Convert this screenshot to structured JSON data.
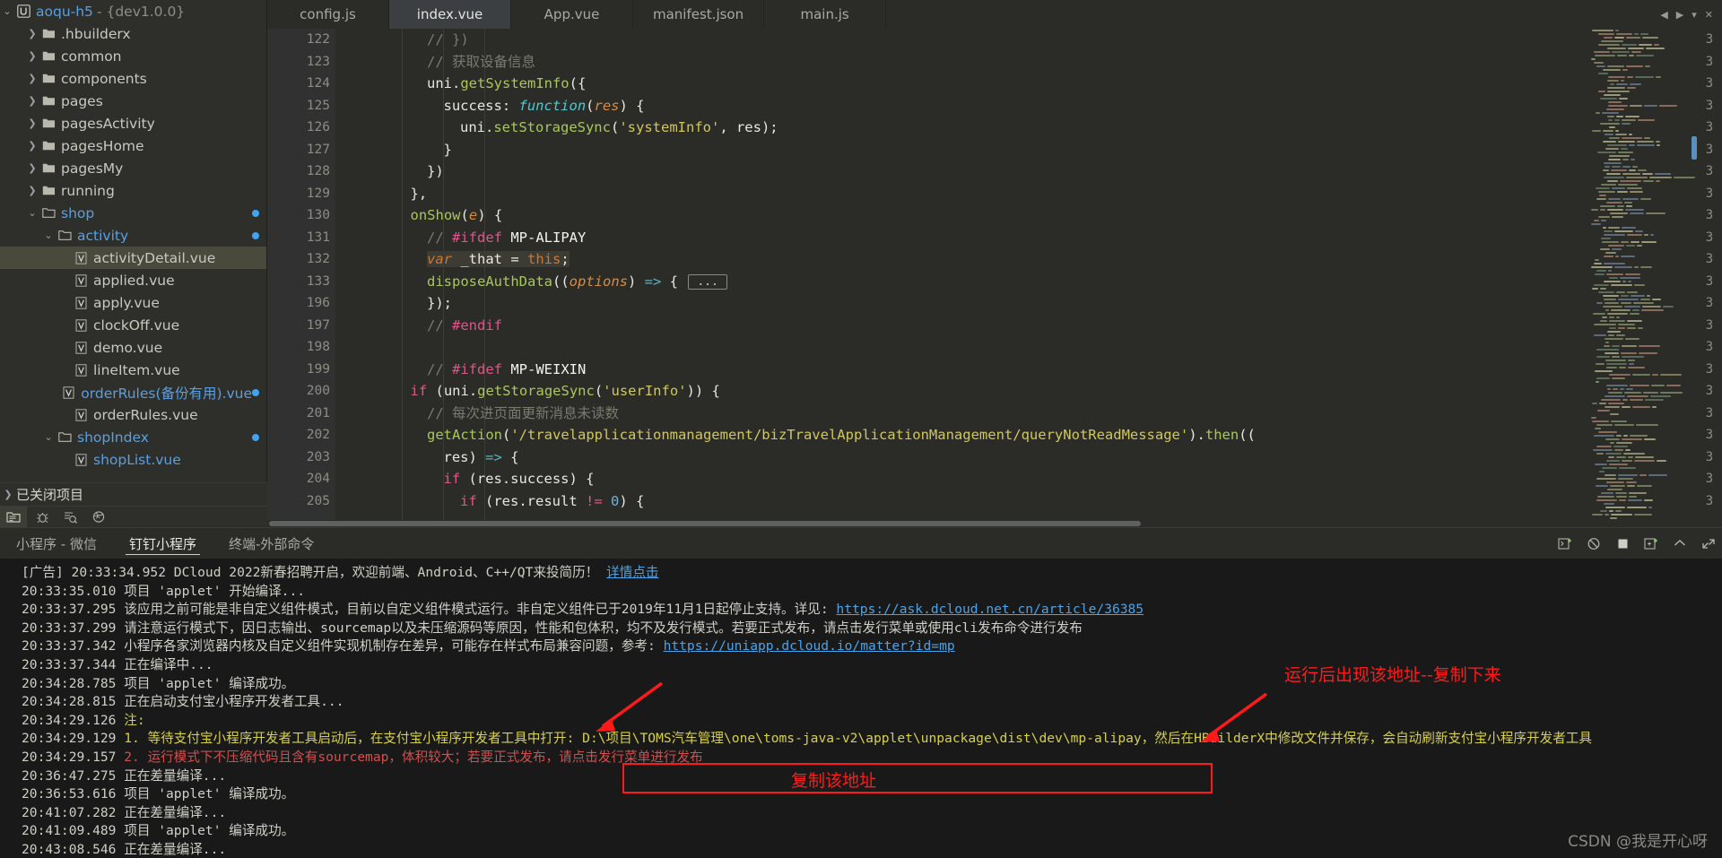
{
  "sidebar": {
    "root": {
      "name": "aoqu-h5",
      "version": "- {dev1.0.0}",
      "icon": "hbuilder-logo-icon"
    },
    "items": [
      {
        "label": ".hbuilderx",
        "type": "folder",
        "depth": 1,
        "expanded": false,
        "dot": false,
        "color": "grey"
      },
      {
        "label": "common",
        "type": "folder",
        "depth": 1,
        "expanded": false,
        "dot": false,
        "color": "grey"
      },
      {
        "label": "components",
        "type": "folder",
        "depth": 1,
        "expanded": false,
        "dot": false,
        "color": "grey"
      },
      {
        "label": "pages",
        "type": "folder",
        "depth": 1,
        "expanded": false,
        "dot": false,
        "color": "grey"
      },
      {
        "label": "pagesActivity",
        "type": "folder",
        "depth": 1,
        "expanded": false,
        "dot": false,
        "color": "grey"
      },
      {
        "label": "pagesHome",
        "type": "folder",
        "depth": 1,
        "expanded": false,
        "dot": false,
        "color": "grey"
      },
      {
        "label": "pagesMy",
        "type": "folder",
        "depth": 1,
        "expanded": false,
        "dot": false,
        "color": "grey"
      },
      {
        "label": "running",
        "type": "folder",
        "depth": 1,
        "expanded": false,
        "dot": false,
        "color": "grey"
      },
      {
        "label": "shop",
        "type": "folder",
        "depth": 1,
        "expanded": true,
        "dot": true,
        "color": "blue"
      },
      {
        "label": "activity",
        "type": "folder",
        "depth": 2,
        "expanded": true,
        "dot": true,
        "color": "blue"
      },
      {
        "label": "activityDetail.vue",
        "type": "vue",
        "depth": 3,
        "selected": true,
        "dot": false,
        "color": "grey"
      },
      {
        "label": "applied.vue",
        "type": "vue",
        "depth": 3,
        "dot": false,
        "color": "grey"
      },
      {
        "label": "apply.vue",
        "type": "vue",
        "depth": 3,
        "dot": false,
        "color": "grey"
      },
      {
        "label": "clockOff.vue",
        "type": "vue",
        "depth": 3,
        "dot": false,
        "color": "grey"
      },
      {
        "label": "demo.vue",
        "type": "vue",
        "depth": 3,
        "dot": false,
        "color": "grey"
      },
      {
        "label": "lineItem.vue",
        "type": "vue",
        "depth": 3,
        "dot": false,
        "color": "grey"
      },
      {
        "label": "orderRules(备份有用).vue",
        "type": "vue",
        "depth": 3,
        "dot": true,
        "color": "blue"
      },
      {
        "label": "orderRules.vue",
        "type": "vue",
        "depth": 3,
        "dot": false,
        "color": "grey"
      },
      {
        "label": "shopIndex",
        "type": "folder",
        "depth": 2,
        "expanded": true,
        "dot": true,
        "color": "blue"
      },
      {
        "label": "shopList.vue",
        "type": "vue",
        "depth": 3,
        "dot": false,
        "color": "blue"
      }
    ],
    "closed_projects": "已关闭项目",
    "tools": [
      {
        "name": "project-manager-icon",
        "active": true
      },
      {
        "name": "debug-icon",
        "active": false
      },
      {
        "name": "search-icon",
        "active": false
      },
      {
        "name": "extensions-icon",
        "active": false
      }
    ]
  },
  "tabs": [
    {
      "label": "config.js",
      "active": false
    },
    {
      "label": "index.vue",
      "active": true
    },
    {
      "label": "App.vue",
      "active": false
    },
    {
      "label": "manifest.json",
      "active": false
    },
    {
      "label": "main.js",
      "active": false
    }
  ],
  "tab_nav": {
    "prev": "◀",
    "next": "▶",
    "list": "▾",
    "close": "✕"
  },
  "editor": {
    "lines": [
      {
        "num": "122",
        "fold": "",
        "indent": 4,
        "html": "<span class='c-cm'>// })</span>"
      },
      {
        "num": "123",
        "fold": "",
        "indent": 4,
        "html": "<span class='c-cm'>// 获取设备信息</span>"
      },
      {
        "num": "124",
        "fold": "-",
        "indent": 4,
        "html": "<span class='c-obj'>uni.</span><span class='c-fn'>getSystemInfo</span><span class='c-obj'>({</span>"
      },
      {
        "num": "125",
        "fold": "-",
        "indent": 5,
        "html": "<span class='c-obj'>success: </span><span class='c-it'>function</span><span class='c-obj'>(</span><span class='c-par'>res</span><span class='c-obj'>) {</span>"
      },
      {
        "num": "126",
        "fold": "",
        "indent": 6,
        "html": "<span class='c-obj'>uni.</span><span class='c-fn'>setStorageSync</span><span class='c-obj'>(</span><span class='c-str'>'systemInfo'</span><span class='c-obj'>, res);</span>"
      },
      {
        "num": "127",
        "fold": "",
        "indent": 5,
        "html": "<span class='c-obj'>}</span>"
      },
      {
        "num": "128",
        "fold": "",
        "indent": 4,
        "html": "<span class='c-obj'>})</span>"
      },
      {
        "num": "129",
        "fold": "",
        "indent": 3,
        "html": "<span class='c-obj'>},</span>"
      },
      {
        "num": "130",
        "fold": "-",
        "indent": 3,
        "html": "<span class='c-fn'>onShow</span><span class='c-obj'>(</span><span class='c-par'>e</span><span class='c-obj'>) {</span>"
      },
      {
        "num": "131",
        "fold": "-",
        "indent": 4,
        "html": "<span class='c-cm'>// </span><span class='c-pre'>#ifdef</span> <span class='c-prew'>MP-ALIPAY</span>"
      },
      {
        "num": "132",
        "fold": "",
        "indent": 4,
        "html": "<span class='hl-token'><span class='c-kw'><i>var</i></span><span class='c-obj'> _that = </span><span class='c-kw'>this</span><span class='c-obj'>;</span></span>"
      },
      {
        "num": "133",
        "fold": "+",
        "indent": 4,
        "html": "<span class='c-fn'>disposeAuthData</span><span class='c-obj'>((</span><span class='c-par'>options</span><span class='c-obj'>) </span><span class='c-arr'>=&gt;</span><span class='c-obj'> { </span><span class='fold-box'>...</span>"
      },
      {
        "num": "196",
        "fold": "",
        "indent": 4,
        "html": "<span class='c-obj'>});</span>"
      },
      {
        "num": "197",
        "fold": "",
        "indent": 4,
        "html": "<span class='c-cm'>// </span><span class='c-pre'>#endif</span>"
      },
      {
        "num": "198",
        "fold": "",
        "indent": 0,
        "html": ""
      },
      {
        "num": "199",
        "fold": "-",
        "indent": 4,
        "html": "<span class='c-cm'>// </span><span class='c-pre'>#ifdef</span> <span class='c-prew'>MP-WEIXIN</span>"
      },
      {
        "num": "200",
        "fold": "-",
        "indent": 3,
        "html": "<span class='c-kwpink'>if</span><span class='c-obj'> (uni.</span><span class='c-fn'>getStorageSync</span><span class='c-obj'>(</span><span class='c-str'>'userInfo'</span><span class='c-obj'>)) {</span>"
      },
      {
        "num": "201",
        "fold": "",
        "indent": 4,
        "html": "<span class='c-cm'>// 每次进页面更新消息未读数</span>"
      },
      {
        "num": "202",
        "fold": "-",
        "indent": 4,
        "html": "<span class='c-fn'>getAction</span><span class='c-obj'>(</span><span class='c-str'>'/travelapplicationmanagement/bizTravelApplicationManagement/queryNotReadMessage'</span><span class='c-obj'>).</span><span class='c-fn'>then</span><span class='c-obj'>((</span>"
      },
      {
        "num": "203",
        "fold": "",
        "indent": 5,
        "html": "<span class='c-obj'>res) </span><span class='c-arr'>=&gt;</span><span class='c-obj'> {</span>"
      },
      {
        "num": "204",
        "fold": "-",
        "indent": 5,
        "html": "<span class='c-kwpink'>if</span><span class='c-obj'> (res.success) {</span>"
      },
      {
        "num": "205",
        "fold": "-",
        "indent": 6,
        "html": "<span class='c-kwpink'>if</span><span class='c-obj'> (res.result </span><span class='c-kwpink'>!=</span><span class='c-obj'> </span><span class='c-num'>0</span><span class='c-obj'>) {</span>"
      }
    ],
    "right_gutter_numbers": [
      "3",
      "3",
      "3",
      "3",
      "3",
      "3",
      "3",
      "3",
      "3",
      "3",
      "3",
      "3",
      "3",
      "3",
      "3",
      "3",
      "3",
      "3",
      "3",
      "3",
      "3",
      "3"
    ]
  },
  "console": {
    "tabs": [
      {
        "label": "小程序 - 微信",
        "active": false
      },
      {
        "label": "钉钉小程序",
        "active": true
      },
      {
        "label": "终端-外部命令",
        "active": false
      }
    ],
    "tools": [
      {
        "name": "new-terminal-icon"
      },
      {
        "name": "clear-console-icon"
      },
      {
        "name": "stop-icon"
      },
      {
        "name": "open-external-icon"
      },
      {
        "name": "collapse-panel-icon"
      },
      {
        "name": "expand-panel-icon"
      }
    ],
    "logs": [
      {
        "ts": "",
        "prefix": "[广告] 20:33:34.952 ",
        "text": "DCloud 2022新春招聘开启，欢迎前端、Android、C++/QT来投简历！ ",
        "link": "详情点击",
        "cls": "lg-ad"
      },
      {
        "ts": "20:33:35.010 ",
        "text": "项目 'applet' 开始编译...",
        "cls": ""
      },
      {
        "ts": "20:33:37.295 ",
        "text": "该应用之前可能是非自定义组件模式，目前以自定义组件模式运行。非自定义组件已于2019年11月1日起停止支持。详见: ",
        "link": "https://ask.dcloud.net.cn/article/36385",
        "cls": ""
      },
      {
        "ts": "20:33:37.299 ",
        "text": "请注意运行模式下，因日志输出、sourcemap以及未压缩源码等原因，性能和包体积，均不及发行模式。若要正式发布，请点击发行菜单或使用cli发布命令进行发布",
        "cls": ""
      },
      {
        "ts": "20:33:37.342 ",
        "text": "小程序各家浏览器内核及自定义组件实现机制存在差异，可能存在样式布局兼容问题，参考: ",
        "link": "https://uniapp.dcloud.io/matter?id=mp",
        "cls": ""
      },
      {
        "ts": "20:33:37.344 ",
        "text": "正在编译中...",
        "cls": ""
      },
      {
        "ts": "20:34:28.785 ",
        "text": "项目 'applet' 编译成功。",
        "cls": ""
      },
      {
        "ts": "20:34:28.815 ",
        "text": "正在启动支付宝小程序开发者工具...",
        "cls": ""
      },
      {
        "ts": "20:34:29.126 ",
        "text": "注:",
        "cls": "lg-note"
      },
      {
        "ts": "20:34:29.129 ",
        "text": "1. 等待支付宝小程序开发者工具启动后，在支付宝小程序开发者工具中打开: D:\\项目\\TOMS汽车管理\\one\\toms-java-v2\\applet\\unpackage\\dist\\dev\\mp-alipay，然后在HBuilderX中修改文件并保存，会自动刷新支付宝小程序开发者工具",
        "cls": "lg-yellow"
      },
      {
        "ts": "20:34:29.157 ",
        "text": "2. 运行模式下不压缩代码且含有sourcemap，体积较大；若要正式发布，请点击发行菜单进行发布",
        "cls": "lg-red"
      },
      {
        "ts": "20:36:47.275 ",
        "text": "正在差量编译...",
        "cls": ""
      },
      {
        "ts": "20:36:53.616 ",
        "text": "项目 'applet' 编译成功。",
        "cls": ""
      },
      {
        "ts": "20:41:07.282 ",
        "text": "正在差量编译...",
        "cls": ""
      },
      {
        "ts": "20:41:09.489 ",
        "text": "项目 'applet' 编译成功。",
        "cls": ""
      },
      {
        "ts": "20:43:08.546 ",
        "text": "正在差量编译...",
        "cls": ""
      }
    ]
  },
  "annotations": {
    "note_right": "运行后出现该地址--复制下来",
    "note_box": "复制该地址",
    "color": "#ff1a1a"
  },
  "watermark": "CSDN @我是开心呀"
}
